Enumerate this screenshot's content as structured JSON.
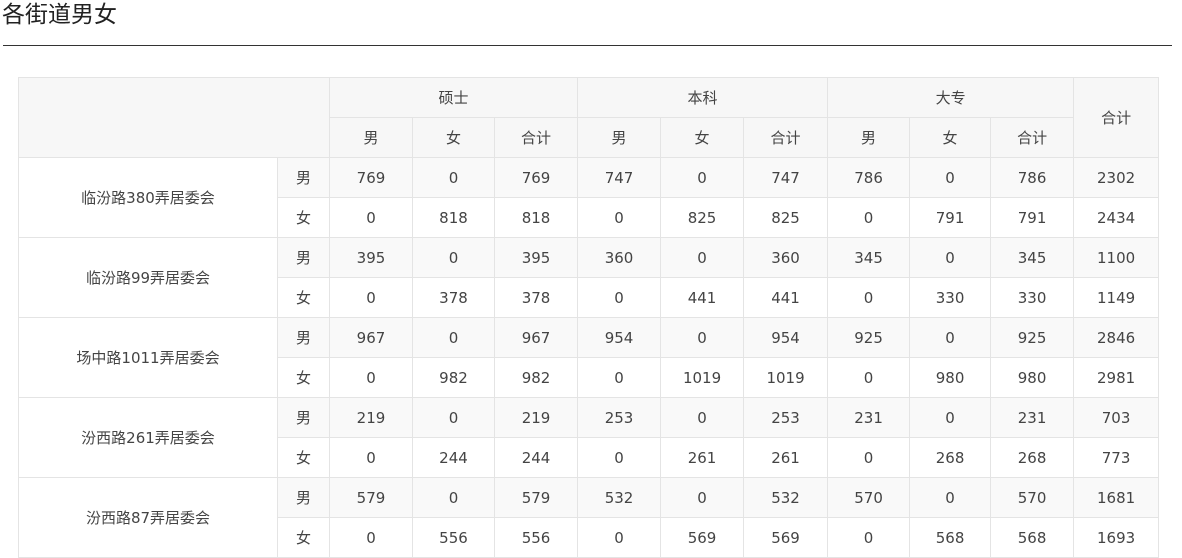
{
  "page": {
    "title": "各街道男女"
  },
  "table": {
    "groups": [
      "硕士",
      "本科",
      "大专"
    ],
    "sub_headers": [
      "男",
      "女",
      "合计"
    ],
    "total_header": "合计",
    "gender_labels": {
      "male": "男",
      "female": "女"
    },
    "streets": [
      {
        "name": "临汾路380弄居委会",
        "male": [
          "769",
          "0",
          "769",
          "747",
          "0",
          "747",
          "786",
          "0",
          "786",
          "2302"
        ],
        "female": [
          "0",
          "818",
          "818",
          "0",
          "825",
          "825",
          "0",
          "791",
          "791",
          "2434"
        ]
      },
      {
        "name": "临汾路99弄居委会",
        "male": [
          "395",
          "0",
          "395",
          "360",
          "0",
          "360",
          "345",
          "0",
          "345",
          "1100"
        ],
        "female": [
          "0",
          "378",
          "378",
          "0",
          "441",
          "441",
          "0",
          "330",
          "330",
          "1149"
        ]
      },
      {
        "name": "场中路1011弄居委会",
        "male": [
          "967",
          "0",
          "967",
          "954",
          "0",
          "954",
          "925",
          "0",
          "925",
          "2846"
        ],
        "female": [
          "0",
          "982",
          "982",
          "0",
          "1019",
          "1019",
          "0",
          "980",
          "980",
          "2981"
        ]
      },
      {
        "name": "汾西路261弄居委会",
        "male": [
          "219",
          "0",
          "219",
          "253",
          "0",
          "253",
          "231",
          "0",
          "231",
          "703"
        ],
        "female": [
          "0",
          "244",
          "244",
          "0",
          "261",
          "261",
          "0",
          "268",
          "268",
          "773"
        ]
      },
      {
        "name": "汾西路87弄居委会",
        "male": [
          "579",
          "0",
          "579",
          "532",
          "0",
          "532",
          "570",
          "0",
          "570",
          "1681"
        ],
        "female": [
          "0",
          "556",
          "556",
          "0",
          "569",
          "569",
          "0",
          "568",
          "568",
          "1693"
        ]
      }
    ]
  }
}
